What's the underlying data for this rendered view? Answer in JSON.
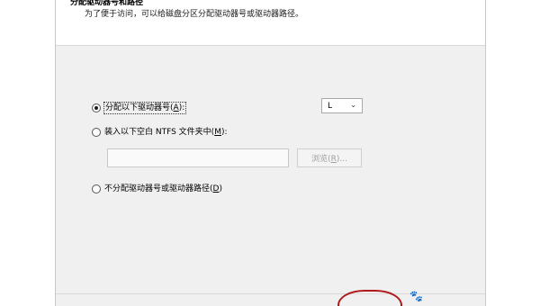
{
  "header": {
    "title": "分配驱动器号和路径",
    "description": "为了便于访问，可以给磁盘分区分配驱动器号或驱动器路径。"
  },
  "options": {
    "assign_letter": {
      "prefix": "分配以下驱动器号(",
      "hotkey": "A",
      "suffix": "):",
      "selected": true
    },
    "mount_folder": {
      "prefix": "装入以下空白 NTFS 文件夹中(",
      "hotkey": "M",
      "suffix": "):",
      "selected": false
    },
    "no_letter": {
      "prefix": "不分配驱动器号或驱动器路径(",
      "hotkey": "D",
      "suffix": ")",
      "selected": false
    }
  },
  "drive_select": {
    "value": "L"
  },
  "path_input": {
    "value": ""
  },
  "browse_button": {
    "prefix": "浏览(",
    "hotkey": "R",
    "suffix": ")..."
  },
  "watermark": {
    "text": "🐾"
  },
  "colors": {
    "highlight": "#b01a1a",
    "content_bg": "#f0f0f0"
  }
}
